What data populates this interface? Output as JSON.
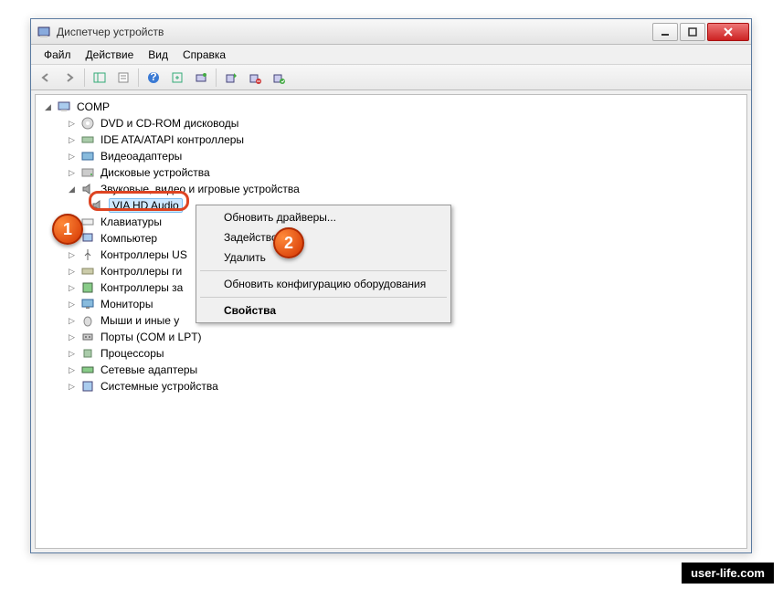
{
  "window": {
    "title": "Диспетчер устройств"
  },
  "menu": {
    "file": "Файл",
    "action": "Действие",
    "view": "Вид",
    "help": "Справка"
  },
  "root": "COMP",
  "nodes": [
    "DVD и CD-ROM дисководы",
    "IDE ATA/ATAPI контроллеры",
    "Видеоадаптеры",
    "Дисковые устройства",
    "Звуковые, видео и игровые устройства",
    "VIA HD Audio",
    "Клавиатуры",
    "Компьютер",
    "Контроллеры US",
    "Контроллеры ги",
    "Контроллеры за",
    "Мониторы",
    "Мыши и иные у",
    "Порты (COM и LPT)",
    "Процессоры",
    "Сетевые адаптеры",
    "Системные устройства"
  ],
  "context": {
    "update_drivers": "Обновить драйверы...",
    "enable": "Задействовать",
    "delete": "Удалить",
    "scan": "Обновить конфигурацию оборудования",
    "properties": "Свойства"
  },
  "badges": {
    "one": "1",
    "two": "2"
  },
  "watermark": "user-life.com"
}
